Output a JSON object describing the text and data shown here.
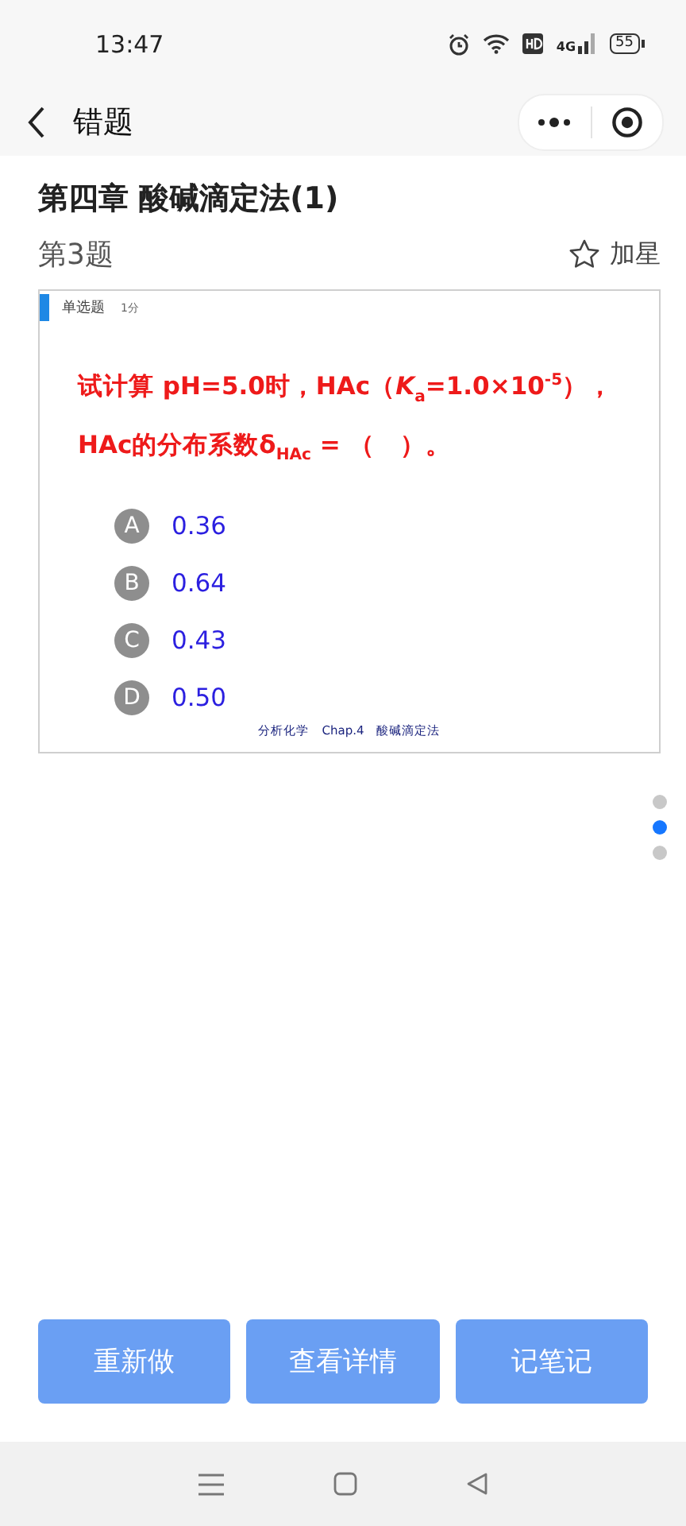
{
  "status_bar": {
    "time": "13:47",
    "network": "4G",
    "battery": "55"
  },
  "nav": {
    "title": "错题"
  },
  "chapter_title": "第四章 酸碱滴定法(1)",
  "question_number": "第3题",
  "star_button": {
    "label": "加星",
    "starred": false
  },
  "question": {
    "type_tag": "单选题",
    "score": "1分",
    "lines": [
      "试计算 pH=5.0时，HAc（*K*$_{a}$=1.0×10$^{-5}$），",
      "HAc的分布系数δ$_{HAc}$ = （　）。"
    ],
    "options": [
      {
        "letter": "A",
        "text": "0.36"
      },
      {
        "letter": "B",
        "text": "0.64"
      },
      {
        "letter": "C",
        "text": "0.43"
      },
      {
        "letter": "D",
        "text": "0.50"
      }
    ],
    "footer": "分析化学　Chap.4　酸碱滴定法"
  },
  "page_dots": [
    {
      "selected": false
    },
    {
      "selected": true
    },
    {
      "selected": false
    }
  ],
  "actions": [
    "重新做",
    "查看详情",
    "记笔记"
  ]
}
